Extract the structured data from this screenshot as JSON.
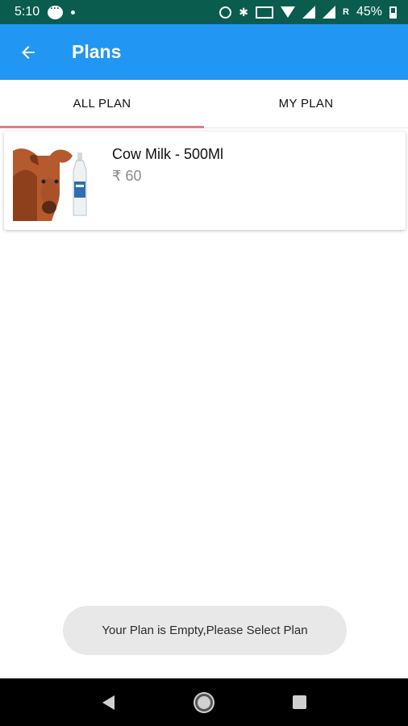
{
  "status_bar": {
    "time": "5:10",
    "roaming": "R",
    "battery": "45%",
    "icons": [
      "message-icon",
      "notification-dot-icon",
      "alarm-icon",
      "bluetooth-icon",
      "volte-icon",
      "wifi-icon",
      "signal-icon",
      "signal-roaming-icon",
      "battery-icon"
    ]
  },
  "app_bar": {
    "back_icon": "arrow-left-icon",
    "title": "Plans",
    "background": "#2196f3"
  },
  "tabs": [
    {
      "label": "ALL PLAN",
      "active": true
    },
    {
      "label": "MY PLAN",
      "active": false
    }
  ],
  "tab_indicator_color": "#e57a87",
  "plans": [
    {
      "name": "Cow Milk - 500Ml",
      "price": "₹ 60",
      "image": "cow-and-milk-bottle-image"
    }
  ],
  "toast": {
    "message": "Your Plan is Empty,Please Select Plan"
  },
  "nav_bar": {
    "buttons": [
      "back-triangle-icon",
      "home-circle-icon",
      "recents-square-icon"
    ]
  }
}
